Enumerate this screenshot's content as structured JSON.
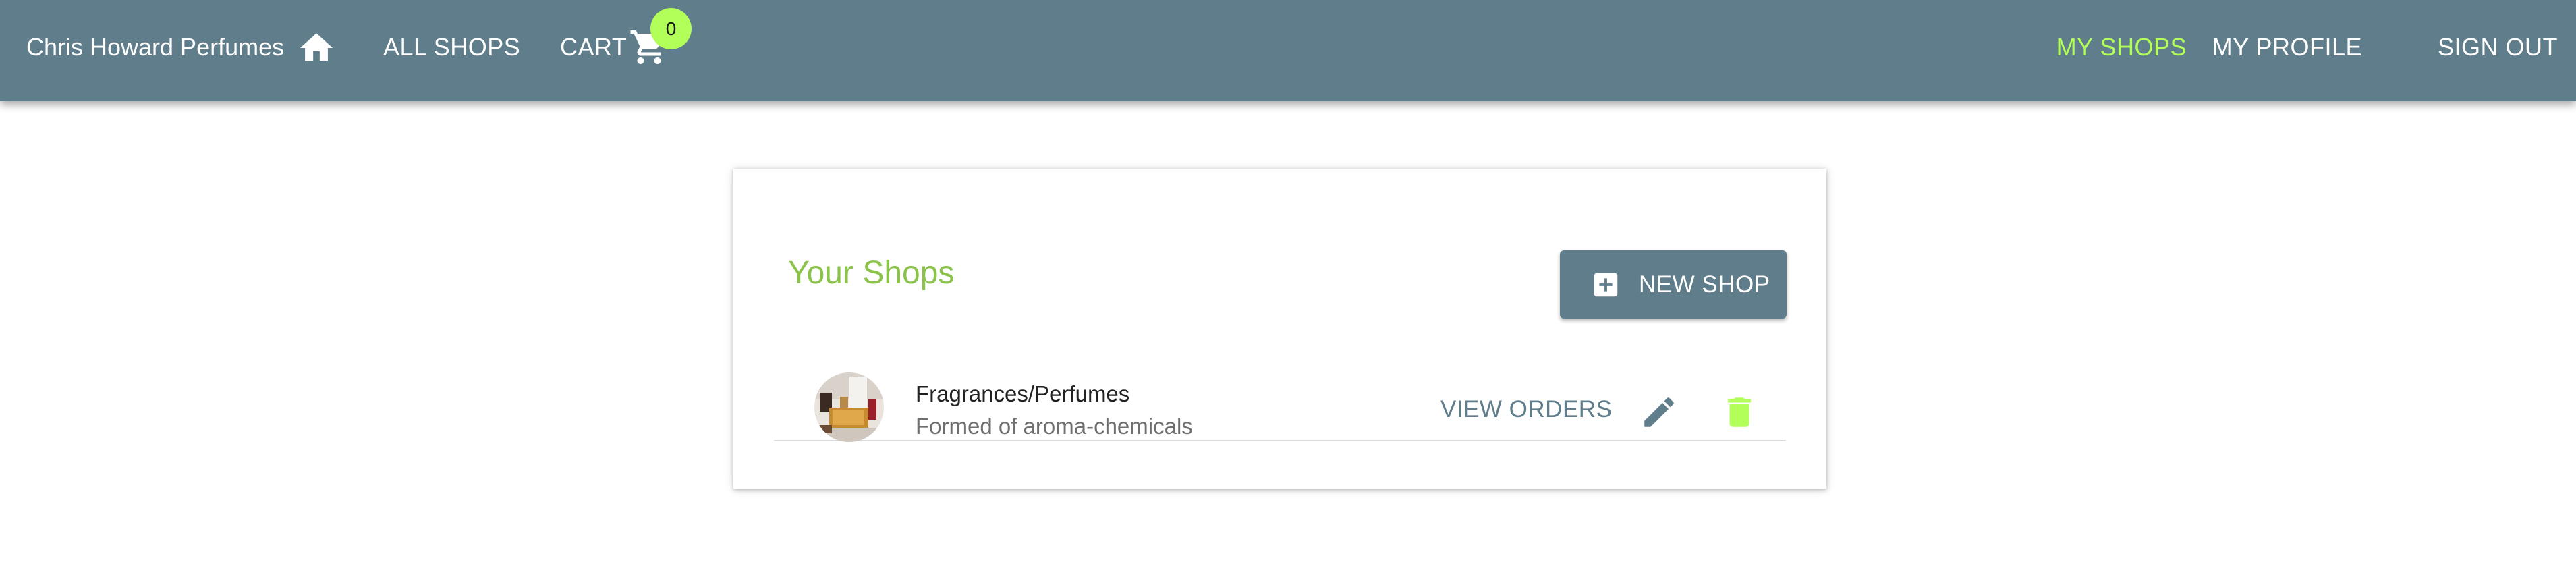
{
  "appbar": {
    "brand": "Chris Howard Perfumes",
    "home_icon": "home-icon",
    "all_shops_label": "ALL SHOPS",
    "cart_label": "CART",
    "cart_icon": "shopping-cart-icon",
    "cart_count": "0",
    "my_shops_label": "MY SHOPS",
    "my_profile_label": "MY PROFILE",
    "sign_out_label": "SIGN OUT"
  },
  "main": {
    "title": "Your Shops",
    "new_shop_label": "NEW SHOP",
    "shops": [
      {
        "name": "Fragrances/Perfumes",
        "description": "Formed of aroma-chemicals",
        "view_orders_label": "VIEW ORDERS",
        "edit_icon": "edit-icon",
        "delete_icon": "delete-icon"
      }
    ]
  },
  "colors": {
    "appbar": "#607d8b",
    "accent_green": "#b2ff59",
    "title_green": "#8bc34a",
    "card_background": "#ffffff"
  }
}
